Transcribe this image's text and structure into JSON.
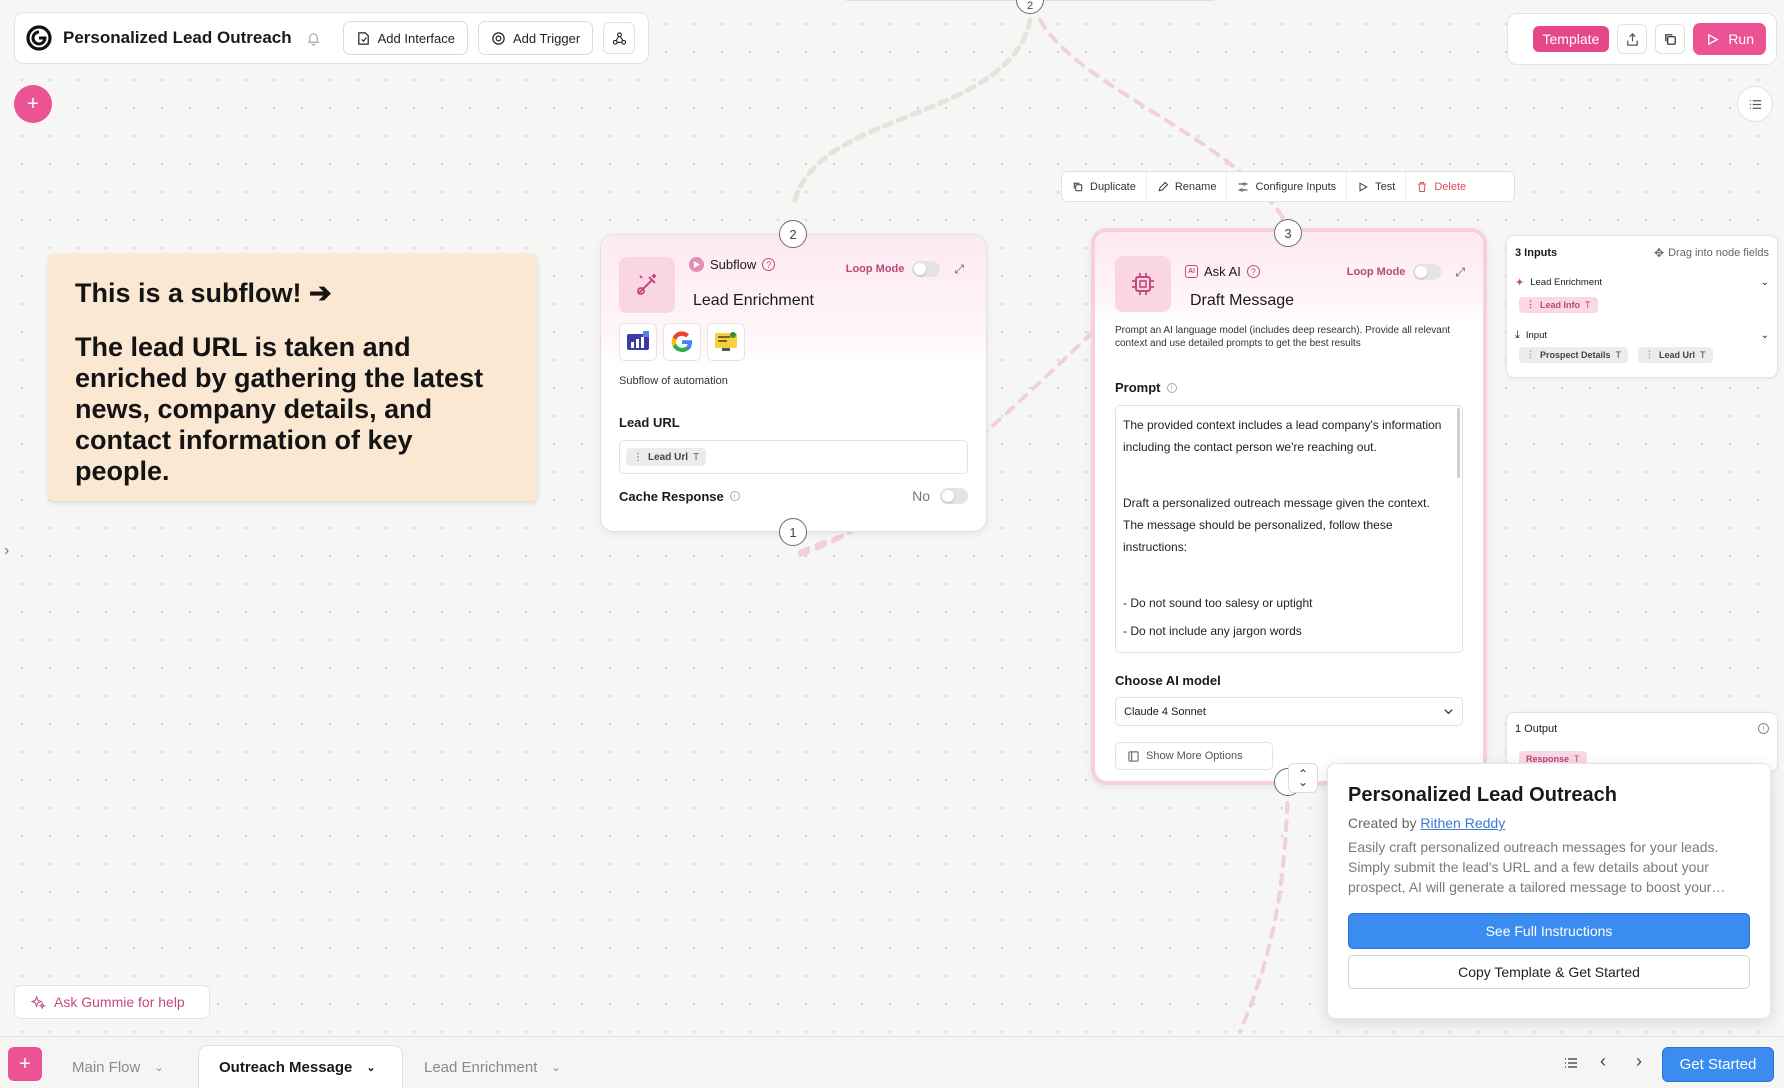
{
  "header": {
    "title": "Personalized Lead Outreach",
    "add_interface": "Add Interface",
    "add_trigger": "Add Trigger"
  },
  "toolbar_right": {
    "template": "Template",
    "run": "Run"
  },
  "note": {
    "heading": "This is a subflow! ➔",
    "body": "The lead URL is taken and enriched by gathering the latest news, company details, and contact information of key people."
  },
  "subflow_node": {
    "number_top": "2",
    "number_bottom": "1",
    "type_label": "Subflow",
    "loop_mode": "Loop Mode",
    "title": "Lead Enrichment",
    "description": "Subflow of automation",
    "lead_url_label": "Lead URL",
    "lead_url_chip": "Lead Url",
    "cache_label": "Cache Response",
    "cache_value": "No"
  },
  "node_toolbar": {
    "duplicate": "Duplicate",
    "rename": "Rename",
    "configure_inputs": "Configure Inputs",
    "test": "Test",
    "delete": "Delete"
  },
  "ai_node": {
    "number_top": "3",
    "type_label": "Ask AI",
    "loop_mode": "Loop Mode",
    "title": "Draft Message",
    "description": "Prompt an AI language model (includes deep research). Provide all relevant context and use detailed prompts to get the best results",
    "prompt_label": "Prompt",
    "prompt_text": [
      "The provided context includes a lead company's information including the contact person we're reaching out.",
      "",
      "Draft a personalized outreach message given the context. The message should be personalized, follow these instructions:",
      "",
      "- Do not sound too salesy or uptight",
      "- Do not include any jargon words"
    ],
    "model_label": "Choose AI model",
    "model_value": "Claude 4 Sonnet",
    "show_more": "Show More Options"
  },
  "inputs_panel": {
    "title": "3 Inputs",
    "drag_hint": "Drag into node fields",
    "group1": "Lead Enrichment",
    "group1_chip": "Lead Info",
    "group2": "Input",
    "group2_chips": [
      "Prospect Details",
      "Lead Url"
    ]
  },
  "output_panel": {
    "title": "1 Output",
    "chip": "Response"
  },
  "info_card": {
    "title": "Personalized Lead Outreach",
    "created_by_prefix": "Created by",
    "author": "Rithen Reddy",
    "description": "Easily craft personalized outreach messages for your leads. Simply submit the lead's URL and a few details about your prospect, AI will generate a tailored message to boost your…",
    "see_full": "See Full Instructions",
    "copy_template": "Copy Template & Get Started"
  },
  "ask_gummie": "Ask Gummie for help",
  "bottom_tabs": [
    "Main Flow",
    "Outreach Message",
    "Lead Enrichment"
  ],
  "get_started": "Get Started",
  "colors": {
    "brand_pink": "#e6478a",
    "accent_blue": "#3b8cf0",
    "note_bg": "#fbe8d3"
  }
}
